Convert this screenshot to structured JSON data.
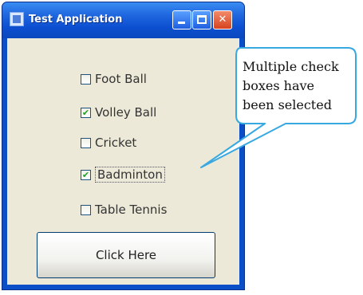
{
  "window": {
    "title": "Test Application",
    "title_icon": "java-cup-icon",
    "controls": [
      "minimize-icon",
      "maximize-icon",
      "close-icon"
    ]
  },
  "checkboxes": [
    {
      "label": "Foot Ball",
      "checked": false
    },
    {
      "label": "Volley Ball",
      "checked": true
    },
    {
      "label": "Cricket",
      "checked": false
    },
    {
      "label": "Badminton",
      "checked": true
    },
    {
      "label": "Table Tennis",
      "checked": false
    }
  ],
  "button": {
    "label": "Click Here"
  },
  "callout": {
    "lines": [
      "Multiple check",
      "boxes have",
      "been selected"
    ]
  },
  "colors": {
    "titlebar": "#1f67df",
    "window_bg": "#ece9d8",
    "callout_border": "#38a8e0",
    "check_mark": "#21a121"
  }
}
